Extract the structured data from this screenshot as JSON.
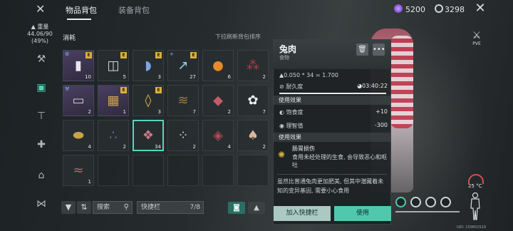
{
  "top_tabs": [
    {
      "label": "物品背包",
      "active": true
    },
    {
      "label": "装备背包",
      "active": false
    }
  ],
  "currency": {
    "gems": "5200",
    "coins": "3298"
  },
  "weight": {
    "label": "重量",
    "value": "44.06/90",
    "percent": "(49%)"
  },
  "sidebar_icons": [
    "wrench-icon",
    "backpack-icon",
    "hammer-icon",
    "medkit-icon",
    "house-icon",
    "butterfly-icon"
  ],
  "inventory": {
    "category": "消耗",
    "sort_hint": "下拉刷新背包排序",
    "items": [
      {
        "name": "milk-box-icon",
        "qty": "10",
        "badge": "E",
        "style": "purple",
        "corner": "⚙"
      },
      {
        "name": "water-jar-icon",
        "qty": "5",
        "badge": "E",
        "style": ""
      },
      {
        "name": "pill-capsule-icon",
        "qty": "3",
        "badge": "E",
        "style": ""
      },
      {
        "name": "syringe-icon",
        "qty": "27",
        "badge": "E",
        "style": "",
        "corner": "+"
      },
      {
        "name": "orange-icon",
        "qty": "6",
        "badge": "",
        "style": ""
      },
      {
        "name": "berries-icon",
        "qty": "2",
        "badge": "",
        "style": ""
      },
      {
        "name": "toolbox-icon",
        "qty": "2",
        "badge": "",
        "style": "purple",
        "corner": "⚒"
      },
      {
        "name": "chest-icon",
        "qty": "1",
        "badge": "E",
        "style": "purple"
      },
      {
        "name": "corn-icon",
        "qty": "3",
        "badge": "E",
        "style": ""
      },
      {
        "name": "roots-icon",
        "qty": "7",
        "badge": "",
        "style": ""
      },
      {
        "name": "raw-meat-icon",
        "qty": "2",
        "badge": "",
        "style": ""
      },
      {
        "name": "flower-icon",
        "qty": "7",
        "badge": "",
        "style": ""
      },
      {
        "name": "potato-icon",
        "qty": "4",
        "badge": "",
        "style": ""
      },
      {
        "name": "blueberries-icon",
        "qty": "2",
        "badge": "",
        "style": ""
      },
      {
        "name": "rabbit-meat-icon",
        "qty": "34",
        "badge": "",
        "style": "selected"
      },
      {
        "name": "eggs-icon",
        "qty": "2",
        "badge": "",
        "style": ""
      },
      {
        "name": "steak-icon",
        "qty": "4",
        "badge": "",
        "style": ""
      },
      {
        "name": "mushroom-icon",
        "qty": "2",
        "badge": "",
        "style": ""
      },
      {
        "name": "sausage-icon",
        "qty": "1",
        "badge": "",
        "style": ""
      }
    ]
  },
  "toolbar": {
    "search_placeholder": "搜索",
    "quickbar_label": "快捷栏",
    "quickbar_count": "7/8"
  },
  "detail": {
    "title": "兔肉",
    "category": "食物",
    "weight_formula": "▲0.050 * 34 = 1.700",
    "timer": "◕03:40:22",
    "durability_label": "耐久度",
    "effects_title": "使用效果",
    "effects": [
      {
        "label": "饱食度",
        "value": "+10"
      },
      {
        "label": "理智值",
        "value": "-300"
      }
    ],
    "side_effects_title": "使用效果",
    "side_effect_name": "肠胃损伤",
    "side_effect_desc": "食用未经处理的生食, 会导致恶心和呕吐",
    "description": "虽然比普通兔肉更加肥美, 但其中潜藏着未知的变异基因, 需要小心食用",
    "btn_quickbar": "加入快捷栏",
    "btn_use": "使用"
  },
  "hud": {
    "mode": "PVE",
    "temperature": "25 °C",
    "uid": "UID: 159802529"
  },
  "colors": {
    "accent": "#50c8ae",
    "accent_light": "#a9c9c2",
    "badge": "#d8b13b",
    "purple_cell": "#4a3f63"
  }
}
